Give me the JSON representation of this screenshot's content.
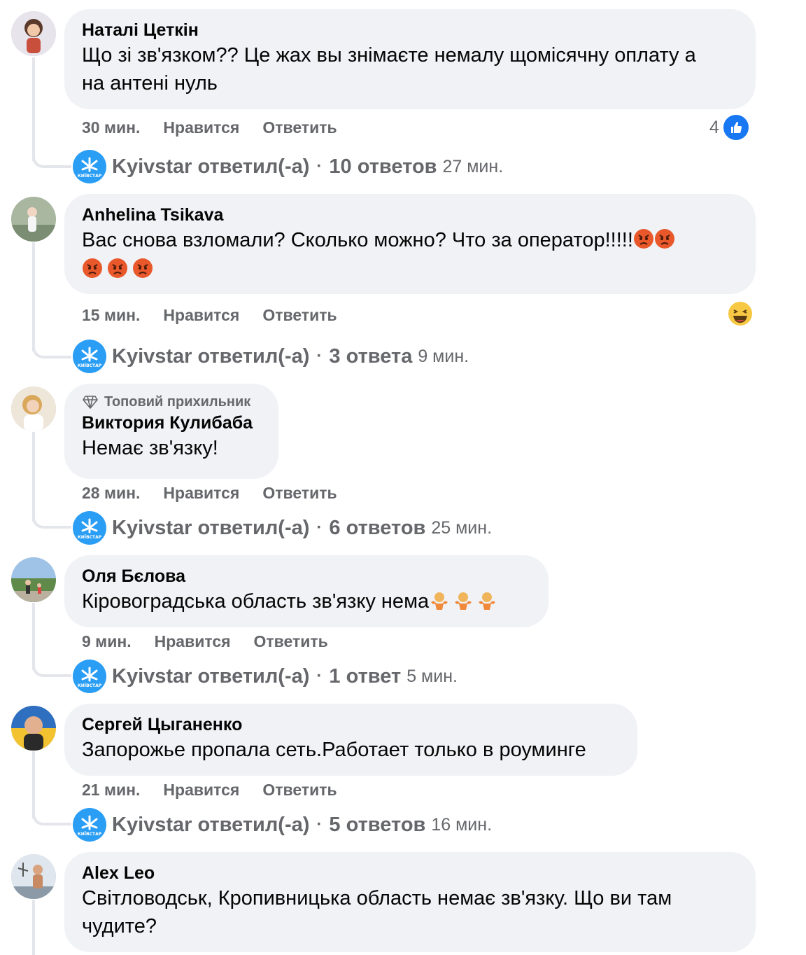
{
  "reply_author": "Kyivstar",
  "reply_verb": "ответил(-а)",
  "actions": {
    "like": "Нравится",
    "reply": "Ответить"
  },
  "comments": [
    {
      "author": "Наталі Цеткін",
      "text_line1": "Що зі зв'язком?? Це жах вы знімаєте немалу щомісячну оплату а",
      "text_line2": "на антені нуль",
      "time": "30 мин.",
      "reactions": "4",
      "replies_count": "10 ответов",
      "replies_time": "27 мин."
    },
    {
      "author": "Anhelina Tsikava",
      "text_line1": "Вас снова взломали? Сколько можно? Что за оператор!!!!!",
      "time": "15 мин.",
      "replies_count": "3 ответа",
      "replies_time": "9 мин."
    },
    {
      "badge": "Топовий прихильник",
      "author": "Виктория Кулибаба",
      "text_line1": "Немає зв'язку!",
      "time": "28 мин.",
      "replies_count": "6 ответов",
      "replies_time": "25 мин."
    },
    {
      "author": "Оля Бєлова",
      "text_line1": "Кіровоградська область зв'язку нема",
      "time": "9 мин.",
      "replies_count": "1 ответ",
      "replies_time": "5 мин."
    },
    {
      "author": "Сергей Цыганенко",
      "text_line1": "Запорожье пропала сеть.Работает только в роуминге",
      "time": "21 мин.",
      "replies_count": "5 ответов",
      "replies_time": "16 мин."
    },
    {
      "author": "Alex Leo",
      "text_line1": "Світловодськ, Кропивницька область немає зв'язку. Що ви там",
      "text_line2": "чудите?"
    }
  ],
  "colors": {
    "bubble": "#f0f2f5",
    "meta": "#65676b",
    "accent": "#1877f2",
    "kyivstar": "#2a9df4"
  },
  "icons": [
    "like-icon",
    "angry-emoji",
    "laughing-emoji",
    "shrug-emoji",
    "diamond-icon",
    "kyivstar-logo"
  ]
}
